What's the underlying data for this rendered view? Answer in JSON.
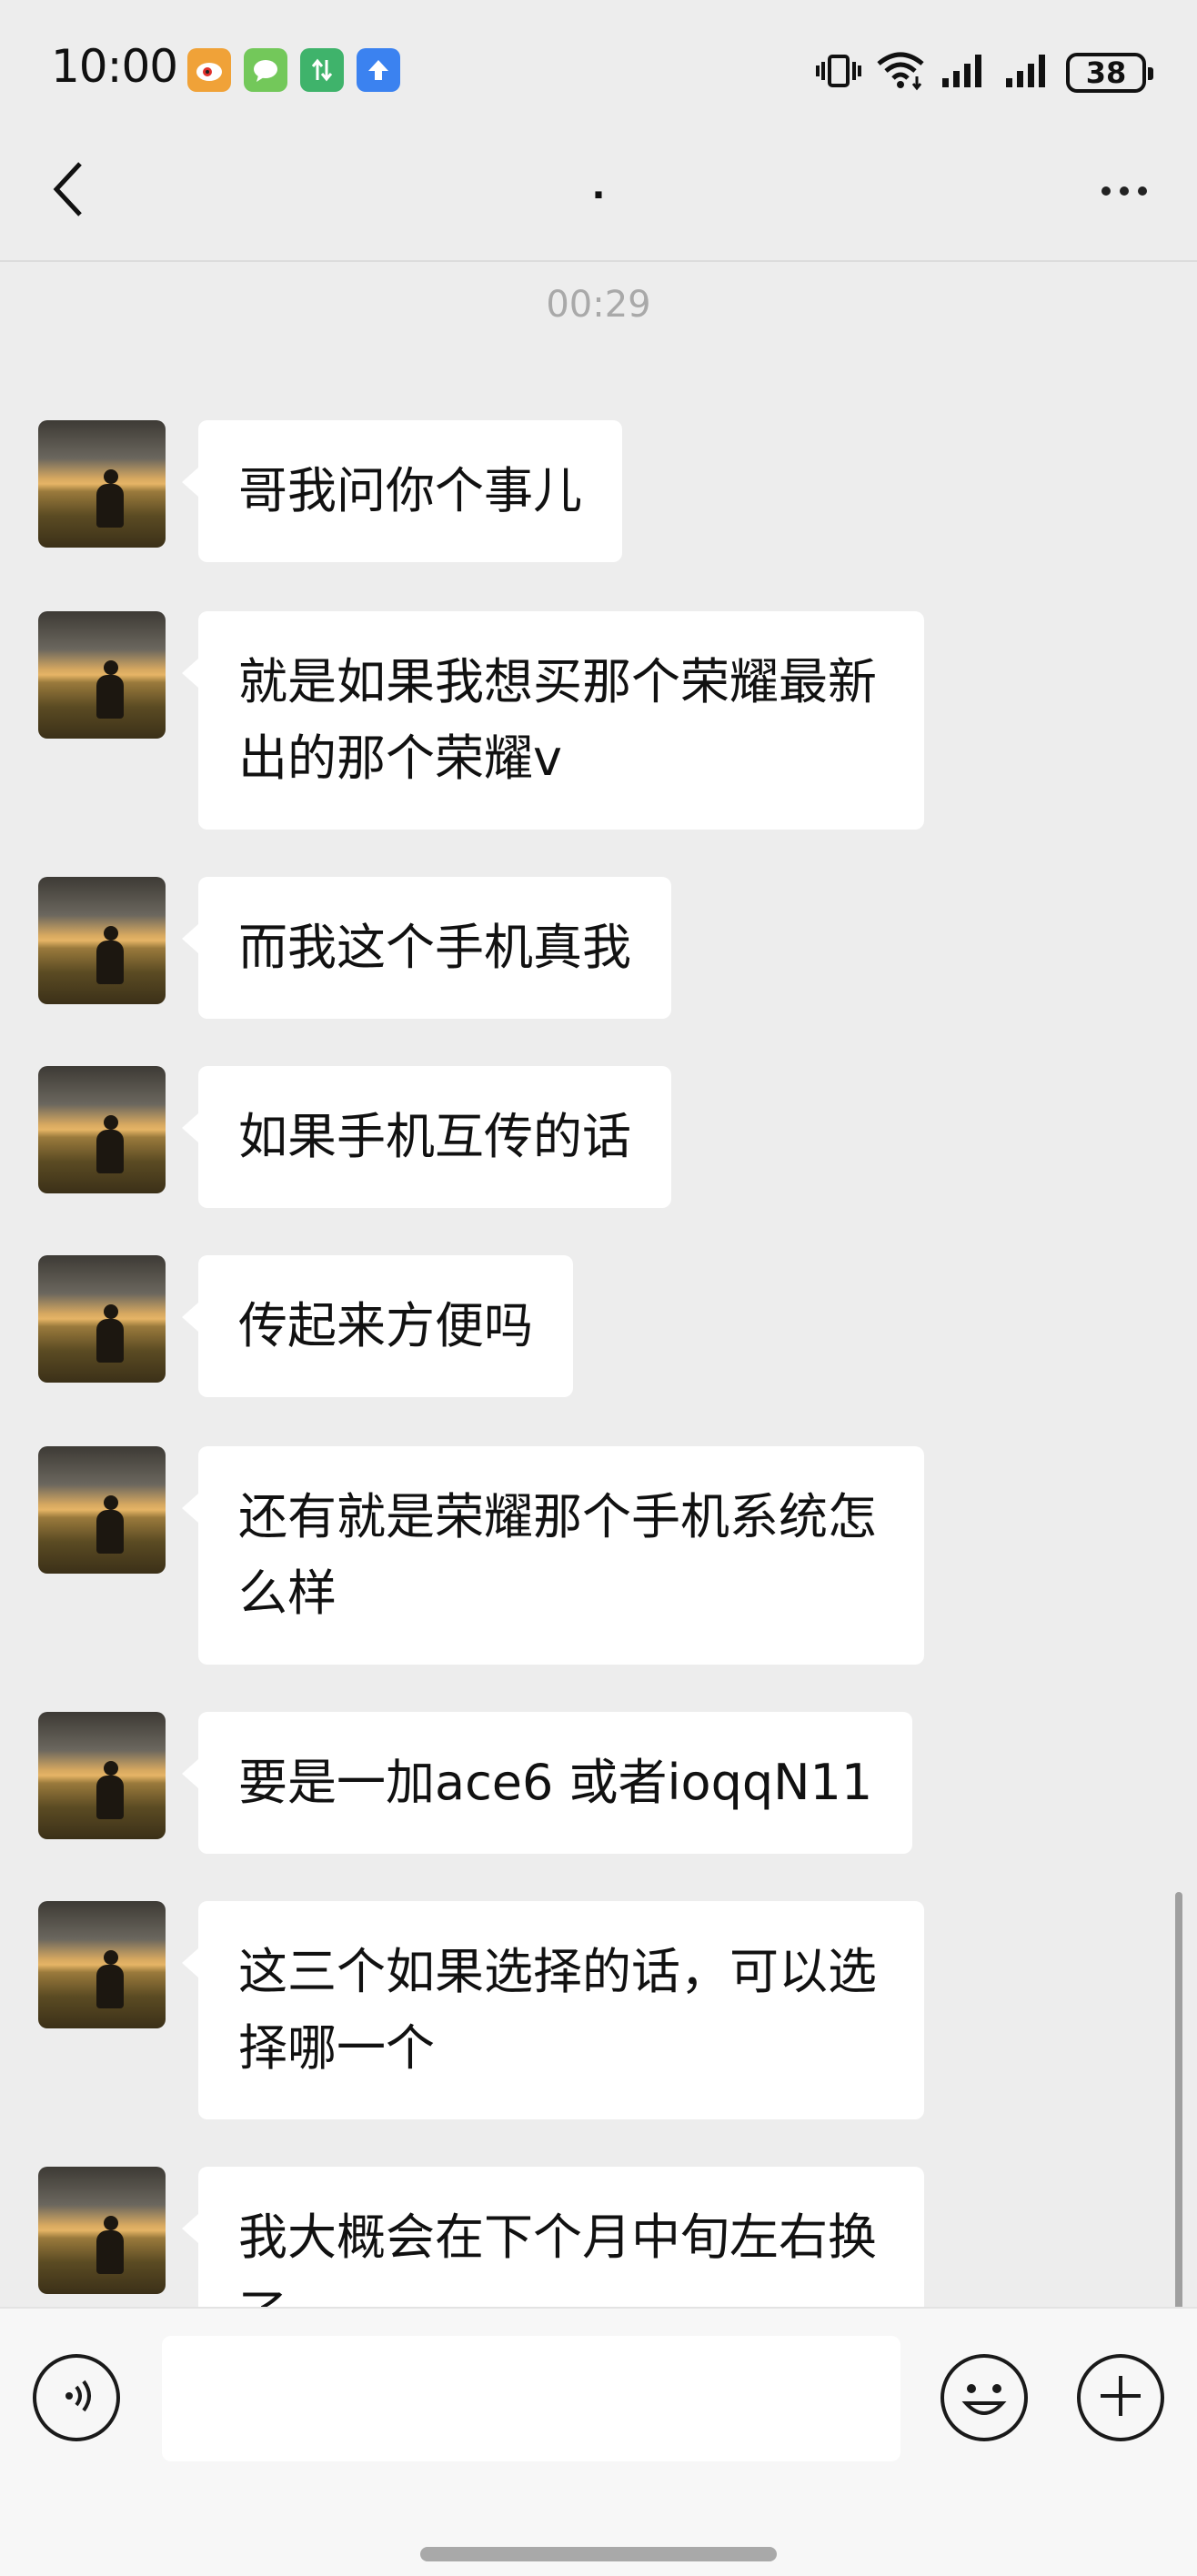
{
  "status_bar": {
    "time": "10:00",
    "notification_icons": [
      "weibo-icon",
      "message-icon",
      "data-sync-icon",
      "upload-icon"
    ],
    "battery_level": "38",
    "icons": [
      "vibrate-icon",
      "wifi-icon",
      "signal-icon",
      "signal-icon",
      "battery-icon"
    ]
  },
  "nav": {
    "title": ".",
    "back_icon": "chevron-left-icon",
    "more_icon": "more-dots-icon"
  },
  "chat": {
    "timestamp": "00:29",
    "messages": [
      {
        "sender": "other",
        "text": "哥我问你个事儿"
      },
      {
        "sender": "other",
        "text": "就是如果我想买那个荣耀最新出的那个荣耀v"
      },
      {
        "sender": "other",
        "text": "而我这个手机真我"
      },
      {
        "sender": "other",
        "text": "如果手机互传的话"
      },
      {
        "sender": "other",
        "text": "传起来方便吗"
      },
      {
        "sender": "other",
        "text": "还有就是荣耀那个手机系统怎么样"
      },
      {
        "sender": "other",
        "text": "要是一加ace6 或者ioqqN11"
      },
      {
        "sender": "other",
        "text": "这三个如果选择的话，可以选择哪一个"
      },
      {
        "sender": "other",
        "text": "我大概会在下个月中旬左右换了"
      }
    ]
  },
  "input_bar": {
    "voice_icon": "voice-input-icon",
    "input_value": "",
    "emoji_icon": "emoji-icon",
    "plus_icon": "plus-icon"
  },
  "colors": {
    "background": "#ededed",
    "bubble": "#ffffff",
    "text": "#111111",
    "timestamp": "#a9a9a9"
  }
}
